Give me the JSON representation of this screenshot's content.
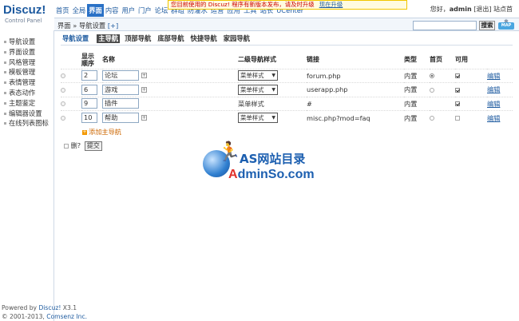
{
  "app": {
    "brand": "Discuz!",
    "subtitle": "Control Panel"
  },
  "top_nav": [
    {
      "label": "首页",
      "active": false
    },
    {
      "label": "全局",
      "active": false
    },
    {
      "label": "界面",
      "active": true
    },
    {
      "label": "内容",
      "active": false
    },
    {
      "label": "用户",
      "active": false
    },
    {
      "label": "门户",
      "active": false
    },
    {
      "label": "论坛",
      "active": false
    },
    {
      "label": "群组",
      "active": false
    },
    {
      "label": "防灌水",
      "active": false
    },
    {
      "label": "运营",
      "active": false
    },
    {
      "label": "应用",
      "active": false
    },
    {
      "label": "工具",
      "active": false
    },
    {
      "label": "站长",
      "active": false
    },
    {
      "label": "UCenter",
      "active": false
    }
  ],
  "notice": {
    "text": "您目前使用的 Discuz! 程序有新版本发布，请及时升级",
    "link": "现在升级"
  },
  "user": {
    "greeting": "您好，",
    "name": "admin",
    "logout": "[退出]",
    "home": "站点首"
  },
  "breadcrumb": {
    "root": "界面",
    "sep": "»",
    "current": "导航设置",
    "add": "[+]"
  },
  "search": {
    "placeholder": "",
    "button": "搜索"
  },
  "map_button": "MAP",
  "left_menu": [
    "导航设置",
    "界面设置",
    "风格管理",
    "模板管理",
    "表情管理",
    "表态动作",
    "主题鉴定",
    "编辑器设置",
    "在线列表图标"
  ],
  "copyright": {
    "line1_prefix": "Powered by ",
    "line1_brand": "Discuz!",
    "line1_version": " X3.1",
    "line2_prefix": "© 2001-2013, ",
    "line2_company": "Comsenz Inc."
  },
  "sub_tabs": {
    "title": "导航设置",
    "items": [
      {
        "label": "主导航",
        "current": true
      },
      {
        "label": "顶部导航",
        "current": false
      },
      {
        "label": "底部导航",
        "current": false
      },
      {
        "label": "快捷导航",
        "current": false
      },
      {
        "label": "家园导航",
        "current": false
      }
    ]
  },
  "table": {
    "headers": {
      "order_line1": "显示",
      "order_line2": "顺序",
      "name": "名称",
      "style": "二级导航样式",
      "link": "链接",
      "type": "类型",
      "home": "首页",
      "enabled": "可用"
    },
    "rows": [
      {
        "order": "2",
        "name": "论坛",
        "has_sub": true,
        "style": "菜单样式",
        "style_select": true,
        "link": "forum.php",
        "type": "内置",
        "home": true,
        "home_radio": true,
        "enabled": true,
        "edit": "编辑"
      },
      {
        "order": "6",
        "name": "游戏",
        "has_sub": true,
        "style": "菜单样式",
        "style_select": true,
        "link": "userapp.php",
        "type": "内置",
        "home": false,
        "home_radio": true,
        "enabled": true,
        "edit": "编辑"
      },
      {
        "order": "9",
        "name": "插件",
        "has_sub": false,
        "style": "菜单样式",
        "style_select": false,
        "link": "#",
        "type": "内置",
        "home": false,
        "home_radio": false,
        "enabled": true,
        "edit": "编辑"
      },
      {
        "order": "10",
        "name": "帮助",
        "has_sub": true,
        "style": "菜单样式",
        "style_select": true,
        "link": "misc.php?mod=faq",
        "type": "内置",
        "home": false,
        "home_radio": true,
        "enabled": false,
        "edit": "编辑"
      }
    ]
  },
  "add_main_nav": "添加主导航",
  "delete_label": "删?",
  "submit_label": "提交",
  "watermark": {
    "line1": "AS网站目录",
    "line2_red": "A",
    "line2_blue": "dminSo.com"
  },
  "colors": {
    "accent": "#2a71c6",
    "link": "#1d5a9f",
    "notice_text": "#cc0000",
    "add_link": "#cc6600"
  }
}
